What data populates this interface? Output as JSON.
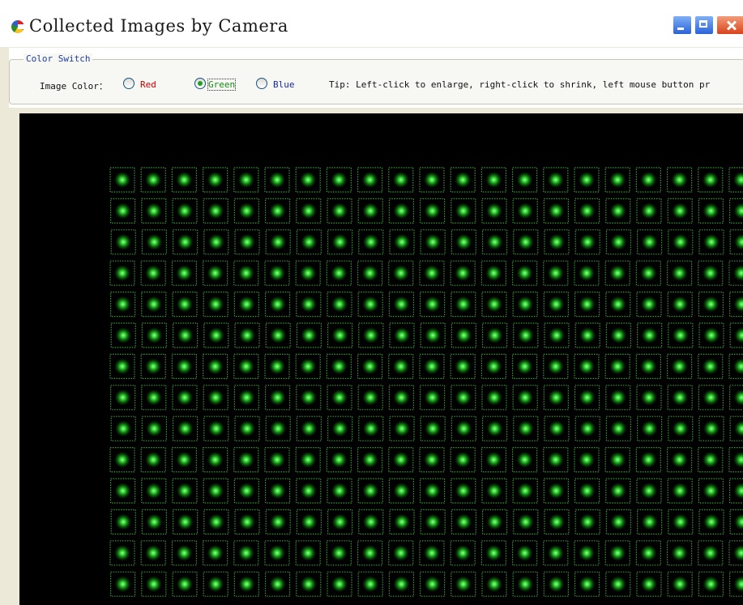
{
  "window": {
    "title": "Collected Images by Camera",
    "buttons": [
      "minimize",
      "maximize",
      "close"
    ]
  },
  "color_switch": {
    "group_label": "Color Switch",
    "image_color_label": "Image Color：",
    "options": [
      {
        "label": "Red",
        "color": "#cc0000",
        "checked": false
      },
      {
        "label": "Green",
        "color": "#1a8a1a",
        "checked": true
      },
      {
        "label": "Blue",
        "color": "#1a2a9a",
        "checked": false
      }
    ],
    "selected": "Green",
    "tip": "Tip: Left-click to enlarge, right-click to shrink, left mouse button pr"
  },
  "camera_image": {
    "description_color": "#1bbf1b",
    "led_color": "#28d028",
    "led_box_color": "#3a9a3a",
    "background": "#000000"
  }
}
